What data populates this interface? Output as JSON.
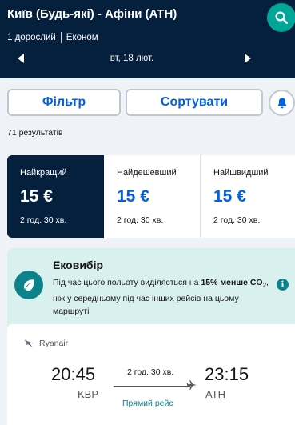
{
  "header": {
    "route": "Київ (Будь-які) - Афіни (ATH)",
    "passengers": "1 дорослий",
    "cabin": "Економ",
    "date": "вт, 18 лют."
  },
  "toolbar": {
    "filter_label": "Фільтр",
    "sort_label": "Сортувати"
  },
  "results_count": "71 результатів",
  "tabs": [
    {
      "title": "Найкращий",
      "price": "15 €",
      "duration": "2 год. 30 хв."
    },
    {
      "title": "Найдешевший",
      "price": "15 €",
      "duration": "2 год. 30 хв."
    },
    {
      "title": "Найшвидший",
      "price": "15 €",
      "duration": "2 год. 30 хв."
    }
  ],
  "eco": {
    "title": "Ековибір",
    "text_before": "Під час цього польоту виділяється на ",
    "text_bold": "15% менше",
    "text_co2": "CO",
    "text_sub": "2",
    "text_after": ", ніж у середньому під час інших рейсів на цьому маршруті"
  },
  "flight": {
    "airline": "Ryanair",
    "dep_time": "20:45",
    "dep_code": "KBP",
    "arr_time": "23:15",
    "arr_code": "ATH",
    "duration": "2 год. 30 хв.",
    "stops": "Прямий рейс"
  },
  "colors": {
    "header_bg": "#05203c",
    "accent": "#0062e3",
    "teal": "#00a698",
    "eco_bg": "#d9f1ee"
  }
}
